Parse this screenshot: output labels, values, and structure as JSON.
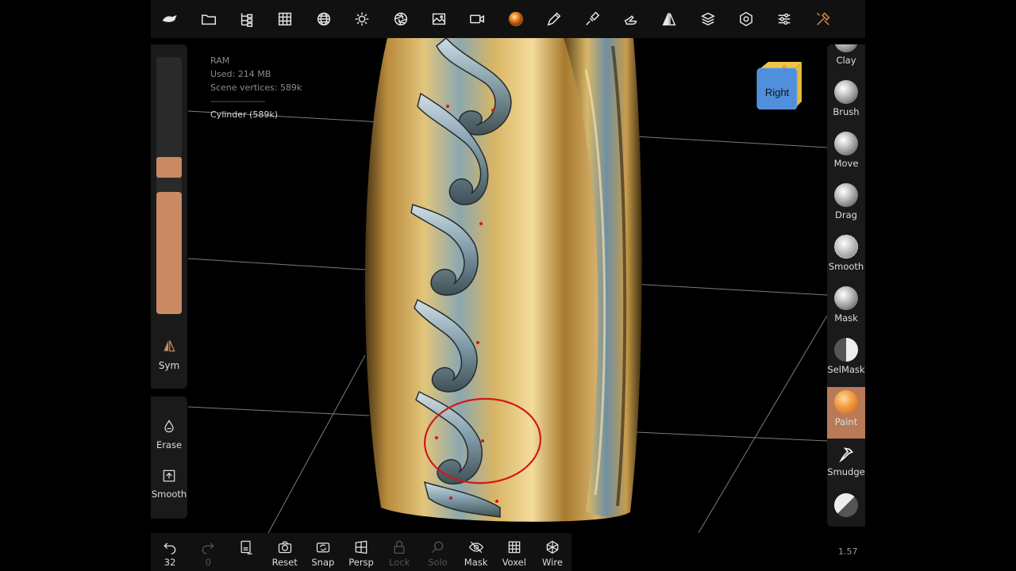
{
  "info": {
    "ram_label": "RAM",
    "used": "Used: 214 MB",
    "vertices": "Scene vertices: 589k",
    "separator": "-----------------------",
    "object": "Cylinder (589k)"
  },
  "left": {
    "sym_label": "Sym",
    "erase_label": "Erase",
    "smooth_label": "Smooth"
  },
  "cube": {
    "face_label": "Right"
  },
  "tools": [
    {
      "label": "Clay"
    },
    {
      "label": "Brush"
    },
    {
      "label": "Move"
    },
    {
      "label": "Drag"
    },
    {
      "label": "Smooth"
    },
    {
      "label": "Mask"
    },
    {
      "label": "SelMask"
    },
    {
      "label": "Paint",
      "active": true
    },
    {
      "label": "Smudge"
    }
  ],
  "bottom": {
    "undo_count": "32",
    "redo_count": "0",
    "reset": "Reset",
    "snap": "Snap",
    "persp": "Persp",
    "lock": "Lock",
    "solo": "Solo",
    "mask": "Mask",
    "voxel": "Voxel",
    "wire": "Wire"
  },
  "zoom": "1.57",
  "colors": {
    "accent": "#e58a3a",
    "slider": "#c98a64",
    "active_tool": "#b87a58",
    "highlight_circle": "#d01818"
  }
}
